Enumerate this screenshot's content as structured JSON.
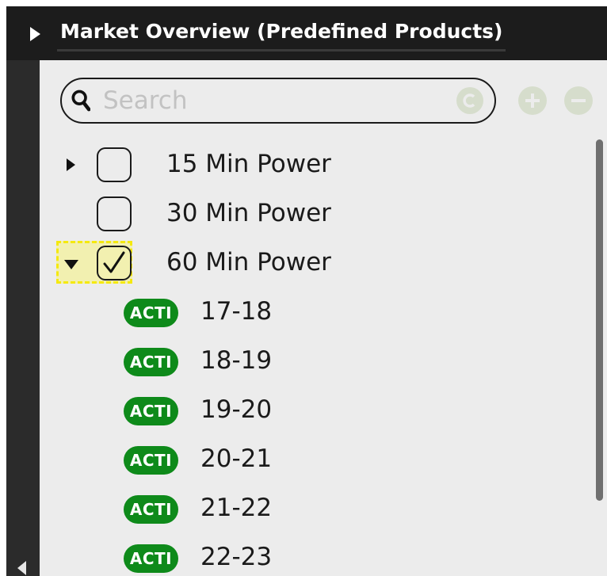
{
  "window": {
    "title": "Market Overview (Predefined Products)"
  },
  "search": {
    "placeholder": "Search",
    "value": ""
  },
  "icons": {
    "collapse_title": "triangle-right-icon",
    "search": "magnifier-icon",
    "clear": "clear-circle-icon",
    "add": "plus-circle-icon",
    "remove": "minus-circle-icon",
    "expand": "triangle-right-icon",
    "collapse": "triangle-down-icon",
    "checkmark": "checkmark-icon",
    "rail": "triangle-left-icon"
  },
  "tree": {
    "products": [
      {
        "label": "15 Min Power",
        "checked": false,
        "expandable": true,
        "expanded": false
      },
      {
        "label": "30 Min Power",
        "checked": false,
        "expandable": false,
        "expanded": false
      },
      {
        "label": "60 Min Power",
        "checked": true,
        "expandable": true,
        "expanded": true,
        "focused": true
      }
    ],
    "contracts": [
      {
        "badge": "ACTI",
        "label": "17-18"
      },
      {
        "badge": "ACTI",
        "label": "18-19"
      },
      {
        "badge": "ACTI",
        "label": "19-20"
      },
      {
        "badge": "ACTI",
        "label": "20-21"
      },
      {
        "badge": "ACTI",
        "label": "21-22"
      },
      {
        "badge": "ACTI",
        "label": "22-23"
      }
    ]
  },
  "colors": {
    "titlebar": "#1c1c1c",
    "panel": "#ececec",
    "badge": "#0e8a1a",
    "focus_highlight": "#f5e90e",
    "disabled_button": "#d6ddcc"
  }
}
